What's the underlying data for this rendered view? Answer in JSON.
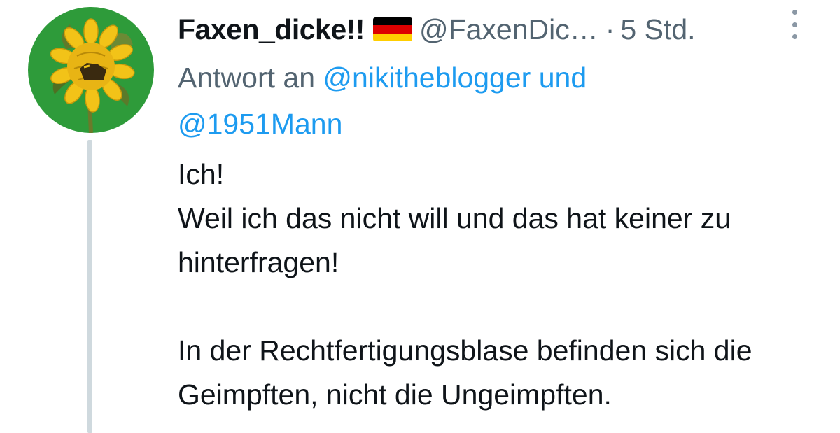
{
  "tweet": {
    "display_name": "Faxen_dicke!!",
    "flag_icon": "germany-flag-icon",
    "handle": "@FaxenDic…",
    "separator": "·",
    "time": "5 Std.",
    "more_icon": "more-vertical-icon",
    "reply_prefix": "Antwort an",
    "reply_mention_1": "@nikitheblogger",
    "reply_conjunction": "und",
    "reply_mention_2": "@1951Mann",
    "text_line_1": "Ich!",
    "text_line_2": "Weil ich das nicht will und das hat keiner zu hinterfragen!",
    "text_line_3": "In der Rechtfertigungsblase befinden sich die Geimpften, nicht die Ungeimpften."
  },
  "colors": {
    "text": "#0f1419",
    "secondary": "#536471",
    "link": "#1d9bf0",
    "thread_line": "#cfd9de",
    "avatar_bg": "#2e9b3a",
    "flag_black": "#000000",
    "flag_red": "#dd0000",
    "flag_gold": "#ffce00"
  }
}
